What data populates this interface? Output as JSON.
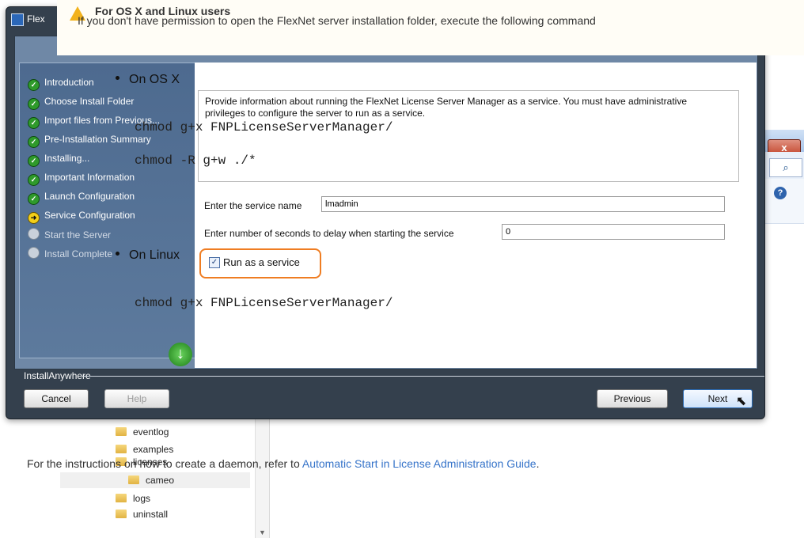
{
  "background_explorer": {
    "close_glyph": "x",
    "search_glyph": "⌕",
    "help_glyph": "?",
    "tree_items": [
      {
        "label": "eventlog"
      },
      {
        "label": "examples"
      },
      {
        "label": "licenses"
      },
      {
        "label": "cameo"
      },
      {
        "label": "logs"
      },
      {
        "label": "uninstall"
      }
    ]
  },
  "installer": {
    "title": "Flex",
    "steps": [
      {
        "label": "Introduction",
        "state": "done"
      },
      {
        "label": "Choose Install Folder",
        "state": "done"
      },
      {
        "label": "Import files from Previous...",
        "state": "done"
      },
      {
        "label": "Pre-Installation Summary",
        "state": "done"
      },
      {
        "label": "Installing...",
        "state": "done"
      },
      {
        "label": "Important Information",
        "state": "done"
      },
      {
        "label": "Launch Configuration",
        "state": "done"
      },
      {
        "label": "Service Configuration",
        "state": "current"
      },
      {
        "label": "Start the Server",
        "state": "pending"
      },
      {
        "label": "Install Complete",
        "state": "pending"
      }
    ],
    "info_text": "Provide information about running the FlexNet License Server Manager as a service. You must have administrative privileges to configure the server to run as a service.",
    "service_name_label": "Enter the service name",
    "service_name_value": "lmadmin",
    "delay_label": "Enter number of seconds to delay when starting the service",
    "delay_value": "0",
    "run_as_service_label": "Run as a service",
    "run_as_service_checked": true,
    "footer_brand": "InstallAnywhere",
    "buttons": {
      "cancel": "Cancel",
      "help": "Help",
      "previous": "Previous",
      "next": "Next"
    }
  },
  "doc_note": {
    "title": "For OS X and Linux users",
    "body": "If you don't have permission to open the FlexNet server installation folder, execute the following command",
    "osx_heading": "On OS X",
    "osx_commands": [
      "chmod g+x FNPLicenseServerManager/",
      "chmod -R g+w ./*"
    ],
    "linux_heading": "On Linux",
    "linux_commands": [
      "chmod g+x FNPLicenseServerManager/"
    ]
  },
  "daemon_note": {
    "prefix": "For the instructions on how to create a daemon, refer to ",
    "link": "Automatic Start in License Administration Guide",
    "suffix": "."
  },
  "colors": {
    "highlight_ring": "#ef7d22",
    "link": "#3573c9",
    "done_step": "#2f9a2b",
    "current_step": "#f4cf19"
  }
}
